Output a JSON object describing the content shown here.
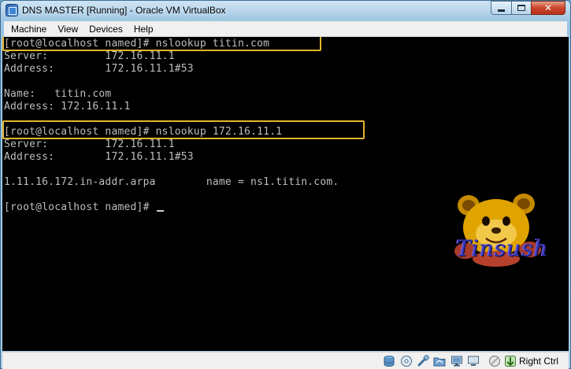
{
  "window": {
    "title": "DNS MASTER [Running] - Oracle VM VirtualBox",
    "minimize_glyph": "minimize-icon",
    "maximize_glyph": "maximize-icon",
    "close_glyph": "✕"
  },
  "menu": {
    "items": [
      "Machine",
      "View",
      "Devices",
      "Help"
    ]
  },
  "console": {
    "lines": [
      "[root@localhost named]# nslookup titin.com",
      "Server:         172.16.11.1",
      "Address:        172.16.11.1#53",
      "",
      "Name:   titin.com",
      "Address: 172.16.11.1",
      "",
      "[root@localhost named]# nslookup 172.16.11.1",
      "Server:         172.16.11.1",
      "Address:        172.16.11.1#53",
      "",
      "1.11.16.172.in-addr.arpa        name = ns1.titin.com.",
      "",
      "[root@localhost named]# "
    ],
    "text_color": "#bdbdbd",
    "background_color": "#000000",
    "highlight_color": "#e2b52a"
  },
  "watermark": {
    "text": "Tinsush",
    "image": "cartoon-bear-watermark"
  },
  "statusbar": {
    "icons": [
      "hard-disk-icon",
      "optical-drive-icon",
      "usb-icon",
      "shared-folders-icon",
      "network-icon",
      "display-icon",
      "video-capture-icon",
      "mouse-integration-icon",
      "host-key-arrow-icon"
    ],
    "host_key": "Right Ctrl"
  }
}
